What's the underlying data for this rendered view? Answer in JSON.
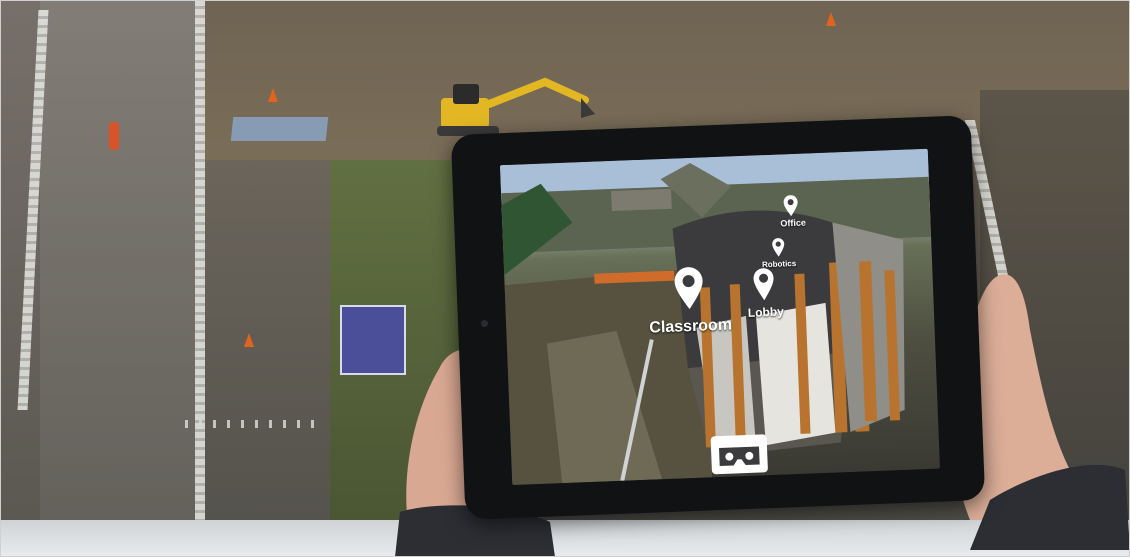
{
  "photo": {
    "subject": "",
    "colors": {
      "ground": "#5e5a4e",
      "grass": "#5a6b3a",
      "tablet_frame": "#111214",
      "sky": "#9fb7d2",
      "building_dark": "#3b3b3d",
      "building_accent": "#b8742f",
      "cone": "#e2631e",
      "excavator": "#e3b623"
    }
  },
  "ar_view": {
    "pins": [
      {
        "label": "Office",
        "icon": "location-pin-icon"
      },
      {
        "label": "Robotics",
        "icon": "location-pin-icon"
      },
      {
        "label": "Classroom",
        "icon": "location-pin-icon"
      },
      {
        "label": "Lobby",
        "icon": "location-pin-icon"
      }
    ],
    "vr_button_icon": "vr-headset-icon"
  }
}
